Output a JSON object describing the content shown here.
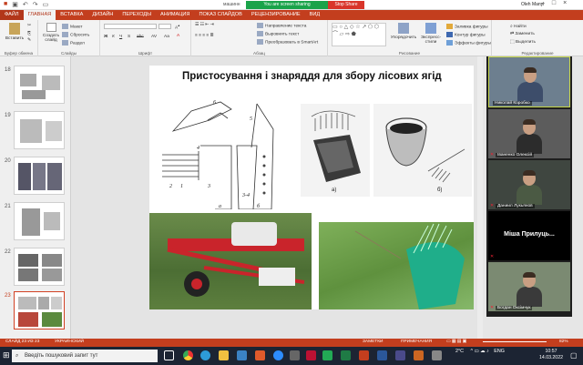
{
  "window": {
    "doc_title_fragment": "машинн",
    "share_status": "You are screen sharing",
    "stop_share": "Stop Share",
    "user_name": "Oleh Manyl"
  },
  "ribbon_tabs": [
    "ФАЙЛ",
    "ГЛАВНАЯ",
    "ВСТАВКА",
    "ДИЗАЙН",
    "ПЕРЕХОДЫ",
    "АНИМАЦИЯ",
    "ПОКАЗ СЛАЙДОВ",
    "РЕЦЕНЗИРОВАНИЕ",
    "ВИД"
  ],
  "ribbon": {
    "clipboard": {
      "paste": "Вставить",
      "label": "Буфер обмена"
    },
    "slides": {
      "new_slide": "Создать слайд",
      "layout": "Макет",
      "reset": "Сбросить",
      "section": "Раздел",
      "label": "Слайды"
    },
    "font": {
      "label": "Шрифт"
    },
    "paragraph": {
      "text_direction": "Направление текста",
      "align_text": "Выровнять текст",
      "smartart": "Преобразовать в SmartArt",
      "label": "Абзац"
    },
    "drawing": {
      "arrange": "Упорядочить",
      "quick_styles": "Экспресс-стили",
      "fill": "Заливка фигуры",
      "outline": "Контур фигуры",
      "effects": "Эффекты фигуры",
      "label": "Рисование"
    },
    "editing": {
      "find": "Найти",
      "replace": "Заменить",
      "select": "Выделить",
      "label": "Редактирование"
    }
  },
  "thumbnails": [
    {
      "number": "18",
      "selected": false
    },
    {
      "number": "19",
      "selected": false
    },
    {
      "number": "20",
      "selected": false
    },
    {
      "number": "21",
      "selected": false
    },
    {
      "number": "22",
      "selected": false
    },
    {
      "number": "23",
      "selected": true
    }
  ],
  "slide": {
    "title": "Пристосування і знаряддя для збору лісових ягід",
    "caption_a": "а)",
    "caption_b": "б)",
    "drawing_labels": [
      "6",
      "2",
      "1",
      "3",
      "5",
      "3-4",
      "a",
      "б",
      "4"
    ]
  },
  "participants": [
    {
      "name": "Николай Коробко",
      "mic_muted": false
    },
    {
      "name": "Іваненко Олексій",
      "mic_muted": true
    },
    {
      "name": "Даниил Лукьянов",
      "mic_muted": true
    },
    {
      "name": "Міша Прилуць...",
      "mic_muted": true
    },
    {
      "name": "Богдан Оксімчук",
      "mic_muted": true
    }
  ],
  "status_bar": {
    "slide_counter": "СЛАЙД 23 ИЗ 23",
    "language": "УКРАИНСКИЙ",
    "notes": "ЗАМЕТКИ",
    "comments": "ПРИМЕЧАНИЯ",
    "zoom": "82%"
  },
  "taskbar": {
    "search_placeholder": "Введіть пошуковий запит тут",
    "temperature": "2°C",
    "keyboard": "ENG",
    "time": "10:57",
    "date": "14.03.2022"
  },
  "colors": {
    "accent": "#c33e1e",
    "share_green": "#1aa34a",
    "stop_red": "#d9352a",
    "taskbar": "#1c2433"
  }
}
